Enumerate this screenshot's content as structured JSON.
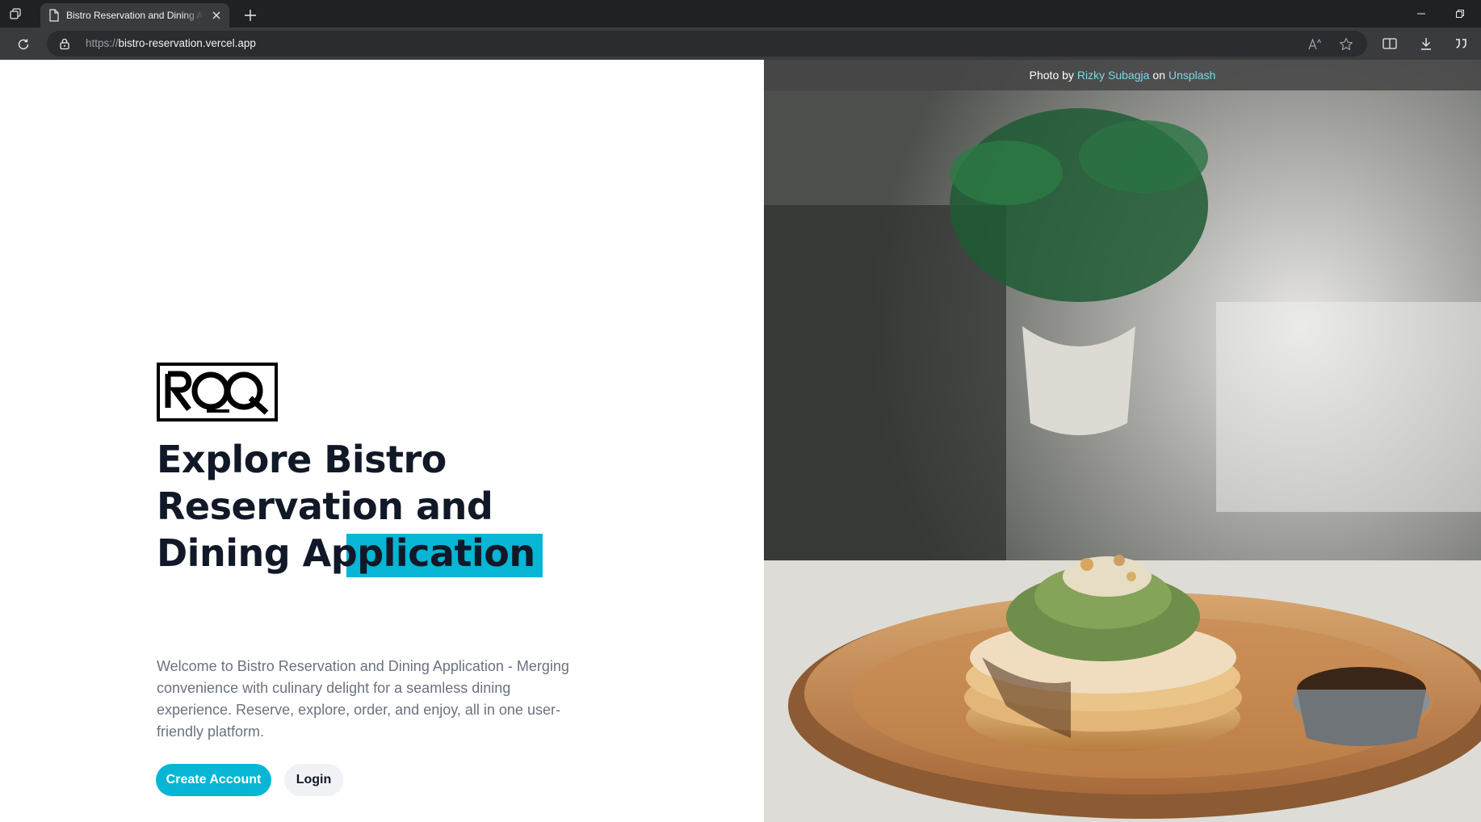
{
  "browser": {
    "tab_title": "Bistro Reservation and Dining Application",
    "url_scheme": "https://",
    "url_host": "bistro-reservation.vercel.app"
  },
  "hero": {
    "logo_text": "RCQ",
    "headline_part1": "Explore Bistro Reservation and Dining A",
    "headline_highlight": "pplication",
    "description": "Welcome to Bistro Reservation and Dining Application - Merging convenience with culinary delight for a seamless dining experience. Reserve, explore, order, and enjoy, all in one user-friendly platform.",
    "primary_button": "Create Account",
    "secondary_button": "Login",
    "accent_color": "#06b6d4"
  },
  "photo_credit": {
    "prefix": "Photo by",
    "author": "Rizky Subagja",
    "middle": "on",
    "source": "Unsplash"
  }
}
